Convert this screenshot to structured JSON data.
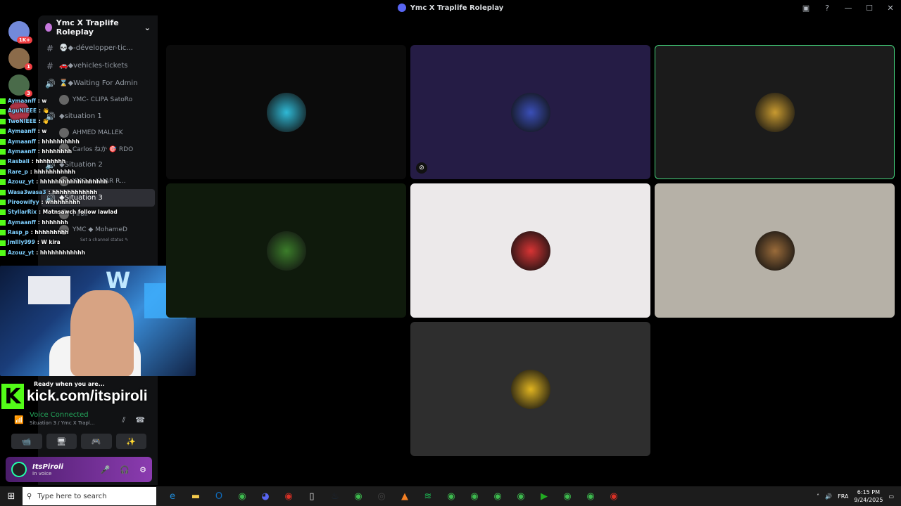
{
  "window": {
    "title": "Ymc X Traplife Roleplay",
    "controls": [
      "▣",
      "?",
      "—",
      "☐",
      "✕"
    ]
  },
  "guilds": [
    {
      "badge": "1K+",
      "color": "#7289da"
    },
    {
      "badge": "1",
      "color": "#8b6b4a"
    },
    {
      "badge": "3",
      "color": "#4a6b4a"
    },
    {
      "badge": "",
      "color": "#a34"
    }
  ],
  "sidebar": {
    "server_name": "Ymc X Traplife Roleplay",
    "channels": [
      {
        "icon": "#",
        "label": "💀◆-développer-tic...",
        "type": "text"
      },
      {
        "icon": "#",
        "label": "🚗◆vehicles-tickets",
        "type": "text"
      },
      {
        "icon": "🔊",
        "label": "⌛◆Waiting For Admin",
        "type": "voice"
      },
      {
        "user": "YMC- CLIPA SatoRo",
        "type": "user"
      },
      {
        "icon": "🔊",
        "label": "◆situation 1",
        "type": "voice"
      },
      {
        "user": "AHMED MALLEK",
        "type": "user"
      },
      {
        "user": "Carlos ねか 🎯 RDO",
        "type": "user"
      },
      {
        "icon": "🔊",
        "label": "◆Situation 2",
        "type": "voice"
      },
      {
        "user": "YMC ◆ KMAR R...",
        "type": "user"
      },
      {
        "icon": "🔊",
        "label": "◆Situation 3",
        "type": "voice",
        "active": true
      },
      {
        "user": "Piroli",
        "type": "user"
      },
      {
        "user": "YMC ◆ MohameD",
        "type": "user"
      }
    ],
    "status_hint": "Set a channel status ✎"
  },
  "chat": [
    {
      "user": "Aymaanff",
      "text": ": w"
    },
    {
      "user": "AguNIEEE",
      "text": ": 👋"
    },
    {
      "user": "TwoNIEEE",
      "text": ": 👋"
    },
    {
      "user": "Aymaanff",
      "text": ": w"
    },
    {
      "user": "Aymaanff",
      "text": ": hhhhhhhhhh"
    },
    {
      "user": "Aymaanff",
      "text": ": hhhhhhhh"
    },
    {
      "user": "Rasbali",
      "text": ": hhhhhhhh"
    },
    {
      "user": "Rare_p",
      "text": ": hhhhhhhhhhh"
    },
    {
      "user": "Azouz_yt",
      "text": ": hhhhhhhhhhhhhhhhhh"
    },
    {
      "user": "Wasa3wasa3",
      "text": ": hhhhhhhhhhhh"
    },
    {
      "user": "Piroowifyy",
      "text": ": whhhhhhhh"
    },
    {
      "user": "StyllarRix",
      "text": ": Matnsawch follow lawlad"
    },
    {
      "user": "Aymaanff",
      "text": ": hhhhhhh"
    },
    {
      "user": "Rasp_p",
      "text": ": hhhhhhhhh"
    },
    {
      "user": "Jmllly999",
      "text": ": W kira"
    },
    {
      "user": "Azouz_yt",
      "text": ": hhhhhhhhhhhh"
    }
  ],
  "stream": {
    "ready": "Ready when you are...",
    "kick_url": "kick.com/itspiroli",
    "kick_letter": "K"
  },
  "voice": {
    "connected": "Voice Connected",
    "location": "Situation 3 / Ymc X Trapl...",
    "buttons": [
      "📹",
      "🖥",
      "🎮",
      "✨"
    ]
  },
  "user": {
    "name": "ItsPiroli",
    "status": "In voice"
  },
  "tiles": [
    {
      "bg": "#0b0b0b",
      "avatar": "#2fb9d6",
      "speaking": false,
      "muted": false
    },
    {
      "bg": "#251c45",
      "avatar": "#3a4fb8",
      "speaking": false,
      "muted": true
    },
    {
      "bg": "#1b1b1b",
      "avatar": "#c89a30",
      "speaking": true,
      "muted": false
    },
    {
      "bg": "#0f1a0c",
      "avatar": "#3b7d2a",
      "speaking": false,
      "muted": false
    },
    {
      "bg": "#ece9ea",
      "avatar": "#d83434",
      "speaking": false,
      "muted": false
    },
    {
      "bg": "#b6b1a7",
      "avatar": "#9a6b3a",
      "speaking": false,
      "muted": false
    },
    {
      "bg": "#2e2e2e",
      "avatar": "#e0b420",
      "speaking": false,
      "muted": false
    }
  ],
  "taskbar": {
    "search_placeholder": "Type here to search",
    "time": "6:15 PM",
    "date": "9/24/2025",
    "lang": "FRA"
  }
}
